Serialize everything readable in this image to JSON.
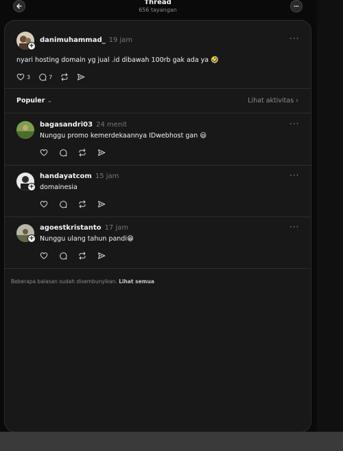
{
  "header": {
    "title": "Thread",
    "views": "656 tayangan"
  },
  "post": {
    "username": "danimuhammad_",
    "time": "19 jam",
    "text": "nyari hosting domain yg jual .id dibawah 100rb gak ada ya 🤣",
    "likes": "3",
    "comments": "7"
  },
  "sort": {
    "label": "Populer",
    "activity_label": "Lihat aktivitas"
  },
  "replies": [
    {
      "username": "bagasandri03",
      "time": "24 menit",
      "text": "Nunggu promo kemerdekaannya IDwebhost gan 😃"
    },
    {
      "username": "handayatcom",
      "time": "15 jam",
      "text": "domainesia"
    },
    {
      "username": "agoestkristanto",
      "time": "17 jam",
      "text": "Nunggu ulang tahun pandi😁"
    }
  ],
  "footer": {
    "note": "Beberapa balasan sudah disembunyikan.",
    "link": "Lihat semua"
  },
  "icons": {
    "back": "arrow-left-icon",
    "more": "ellipsis-icon",
    "like": "heart-icon",
    "comment": "comment-bubble-icon",
    "repost": "repost-icon",
    "share": "send-icon"
  },
  "colors": {
    "background": "#0a0a0a",
    "card": "#181818",
    "text": "#f3f5f7",
    "muted": "#8c8c8c"
  }
}
